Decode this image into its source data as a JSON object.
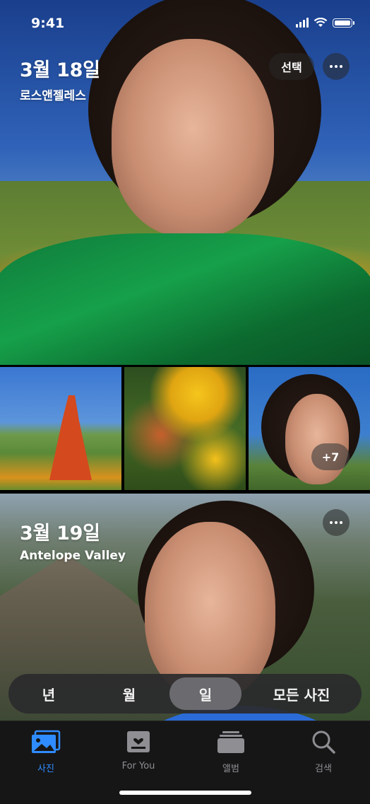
{
  "status_bar": {
    "time": "9:41"
  },
  "day1": {
    "title": "3월 18일",
    "location": "로스앤젤레스",
    "select_label": "선택"
  },
  "grid": {
    "more_count": "+7"
  },
  "day2": {
    "title": "3월 19일",
    "location": "Antelope Valley"
  },
  "segment": {
    "items": [
      "년",
      "월",
      "일",
      "모든 사진"
    ],
    "active": "일"
  },
  "tabs": [
    {
      "label": "사진",
      "icon": "photos-icon",
      "active": true
    },
    {
      "label": "For You",
      "icon": "for-you-icon",
      "active": false
    },
    {
      "label": "앨범",
      "icon": "albums-icon",
      "active": false
    },
    {
      "label": "검색",
      "icon": "search-icon",
      "active": false
    }
  ],
  "colors": {
    "accent": "#2f8cff",
    "tabbar_bg": "#161617",
    "inactive_tab": "#8e8e93"
  }
}
